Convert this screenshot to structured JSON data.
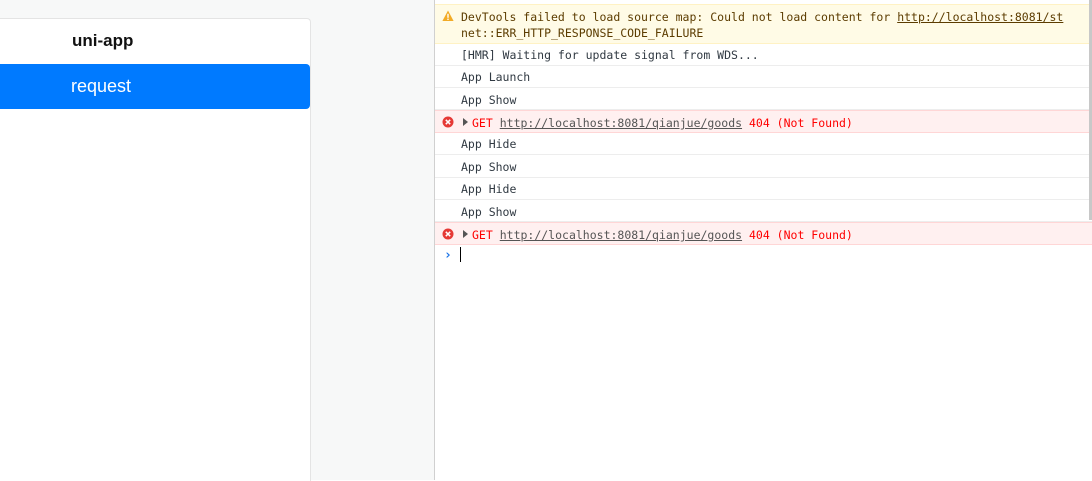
{
  "simulator": {
    "app_title": "uni-app",
    "request_button": "request"
  },
  "console": {
    "warning": {
      "prefix": "DevTools failed to load source map: Could not load content for ",
      "url": "http://localhost:8081/st",
      "line2": "net::ERR_HTTP_RESPONSE_CODE_FAILURE"
    },
    "messages": [
      {
        "text": "[HMR] Waiting for update signal from WDS..."
      },
      {
        "text": "App Launch"
      },
      {
        "text": "App Show"
      },
      {
        "method": "GET",
        "url": "http://localhost:8081/qianjue/goods",
        "status": "404 (Not Found)"
      },
      {
        "text": "App Hide"
      },
      {
        "text": "App Show"
      },
      {
        "text": "App Hide"
      },
      {
        "text": "App Show"
      },
      {
        "method": "GET",
        "url": "http://localhost:8081/qianjue/goods",
        "status": "404 (Not Found)"
      }
    ],
    "prompt_symbol": "›"
  },
  "colors": {
    "accent": "#007aff",
    "error": "#ff0000",
    "warning_bg": "#fffbe6"
  }
}
